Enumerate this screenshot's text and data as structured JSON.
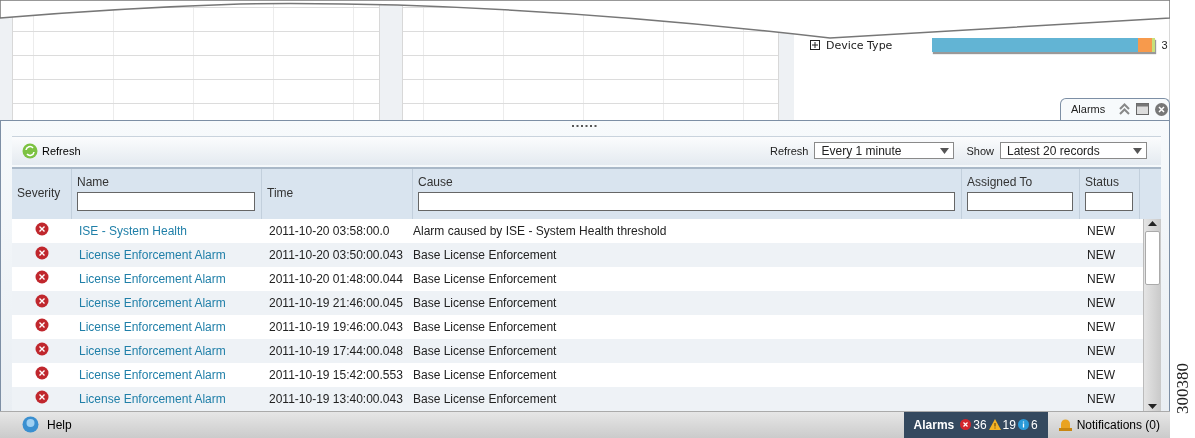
{
  "dashboard": {
    "device_type": {
      "label": "Device Type",
      "value": "3",
      "expanded": false,
      "segments": [
        {
          "color": "#62b4d4",
          "level": 0.92
        },
        {
          "color": "#f79a4c",
          "level": 0.065
        },
        {
          "color": "#c8e07a",
          "level": 0.015
        }
      ]
    }
  },
  "alarms_panel": {
    "tab": {
      "title": "Alarms"
    },
    "toolbar": {
      "refresh_button": "Refresh",
      "refresh_label": "Refresh",
      "refresh_select": "Every 1 minute",
      "show_label": "Show",
      "show_select": "Latest 20 records"
    },
    "columns": [
      {
        "label": "Severity",
        "filter": false
      },
      {
        "label": "Name",
        "filter": true
      },
      {
        "label": "Time",
        "filter": false
      },
      {
        "label": "Cause",
        "filter": true
      },
      {
        "label": "Assigned To",
        "filter": true
      },
      {
        "label": "Status",
        "filter": true
      }
    ],
    "rows": [
      {
        "name": "ISE - System Health",
        "time": "2011-10-20 03:58:00.0",
        "cause": "Alarm caused by ISE - System Health threshold",
        "status": "NEW"
      },
      {
        "name": "License Enforcement Alarm",
        "time": "2011-10-20 03:50:00.043",
        "cause": "Base License Enforcement",
        "status": "NEW"
      },
      {
        "name": "License Enforcement Alarm",
        "time": "2011-10-20 01:48:00.044",
        "cause": "Base License Enforcement",
        "status": "NEW"
      },
      {
        "name": "License Enforcement Alarm",
        "time": "2011-10-19 21:46:00.045",
        "cause": "Base License Enforcement",
        "status": "NEW"
      },
      {
        "name": "License Enforcement Alarm",
        "time": "2011-10-19 19:46:00.043",
        "cause": "Base License Enforcement",
        "status": "NEW"
      },
      {
        "name": "License Enforcement Alarm",
        "time": "2011-10-19 17:44:00.048",
        "cause": "Base License Enforcement",
        "status": "NEW"
      },
      {
        "name": "License Enforcement Alarm",
        "time": "2011-10-19 15:42:00.553",
        "cause": "Base License Enforcement",
        "status": "NEW"
      },
      {
        "name": "License Enforcement Alarm",
        "time": "2011-10-19 13:40:00.043",
        "cause": "Base License Enforcement",
        "status": "NEW"
      }
    ]
  },
  "status_bar": {
    "help": "Help",
    "alarms": {
      "label": "Alarms",
      "critical": "36",
      "warning": "19",
      "info": "6"
    },
    "notifications": "Notifications (0)"
  },
  "figure_number": "300380"
}
